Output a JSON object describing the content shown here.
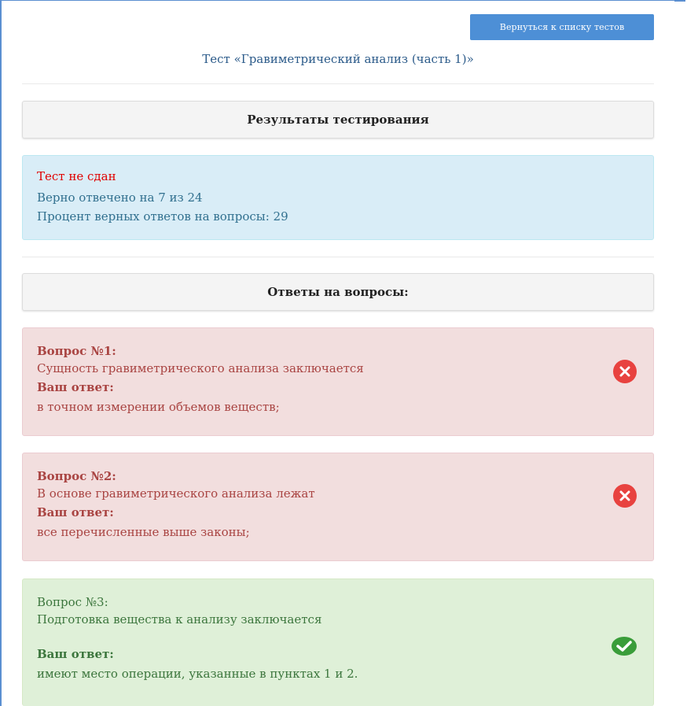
{
  "header": {
    "back_button_label": "Вернуться к списку тестов",
    "test_title": "Тест «Гравиметрический анализ (часть 1)»"
  },
  "results": {
    "header_label": "Результаты тестирования",
    "status_text": "Тест не сдан",
    "correct_text": "Верно отвечено на 7 из 24",
    "percent_text": "Процент верных ответов на вопросы: 29",
    "status_color": "#e00000"
  },
  "answers": {
    "header_label": "Ответы на вопросы:",
    "questions": [
      {
        "title": "Вопрос №1:",
        "text": "Сущность гравиметрического анализа заключается",
        "answer_label": "Ваш ответ:",
        "answer": "в точном измерении объемов веществ;",
        "status": "wrong",
        "icon": "x-circle-icon"
      },
      {
        "title": "Вопрос №2:",
        "text": "В основе гравиметрического анализа лежат",
        "answer_label": "Ваш ответ:",
        "answer": "все перечисленные выше законы;",
        "status": "wrong",
        "icon": "x-circle-icon"
      },
      {
        "title": "Вопрос №3:",
        "text": "Подготовка вещества к анализу заключается",
        "answer_label": "Ваш ответ:",
        "answer": "имеют место операции, указанные в пунктах 1 и 2.",
        "status": "right",
        "icon": "check-circle-icon"
      }
    ]
  },
  "colors": {
    "accent": "#4d8fd6",
    "wrong_bg": "#f2dede",
    "wrong_text": "#a94442",
    "right_bg": "#dff0d8",
    "right_text": "#3c763d",
    "info_bg": "#d9edf7",
    "info_text": "#31708f",
    "wrong_icon": "#e8423f",
    "right_icon": "#3a9d3a"
  }
}
